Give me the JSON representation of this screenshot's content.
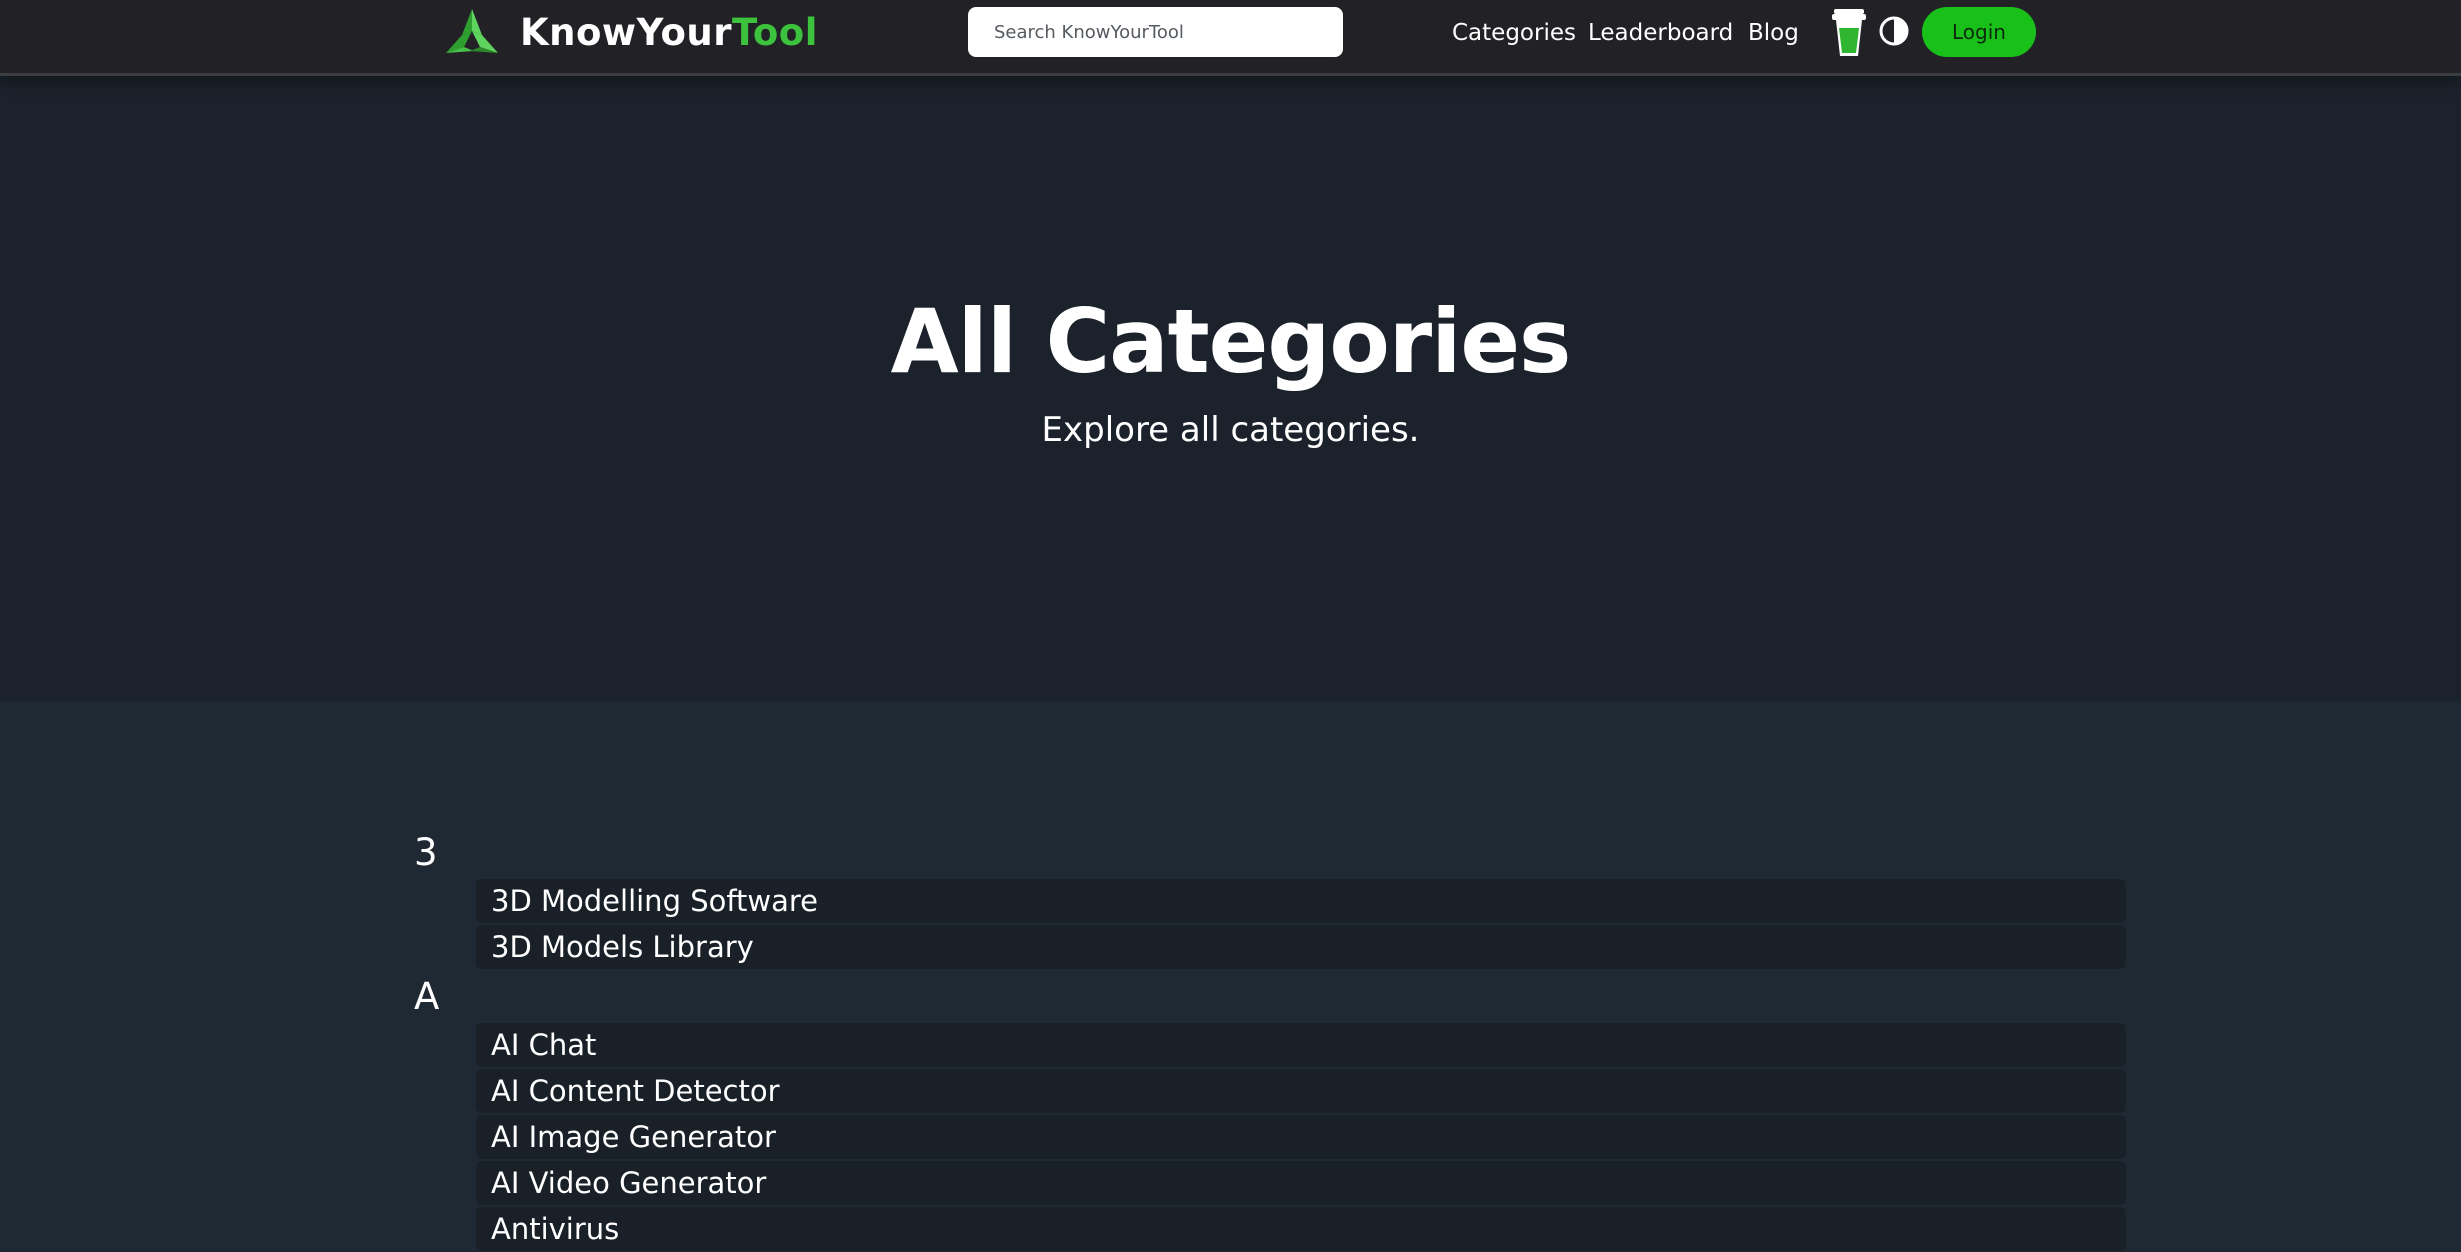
{
  "header": {
    "brand": {
      "name_part1": "KnowYour",
      "name_part2": "Tool"
    },
    "search": {
      "placeholder": "Search KnowYourTool",
      "value": ""
    },
    "nav": [
      {
        "label": "Categories"
      },
      {
        "label": "Leaderboard"
      },
      {
        "label": "Blog"
      }
    ],
    "login_label": "Login"
  },
  "hero": {
    "title": "All Categories",
    "subtitle": "Explore all categories."
  },
  "groups": [
    {
      "letter": "3",
      "items": [
        "3D Modelling Software",
        "3D Models Library"
      ]
    },
    {
      "letter": "A",
      "items": [
        "AI Chat",
        "AI Content Detector",
        "AI Image Generator",
        "AI Video Generator",
        "Antivirus"
      ]
    }
  ],
  "icons": {
    "logo": "knowyourtool-logo",
    "cup": "coffee-cup-icon",
    "theme": "theme-toggle-icon"
  },
  "colors": {
    "accent": "#3cc23c",
    "login_bg": "#19c019",
    "header_bg": "#222226",
    "hero_bg": "#1b222b",
    "list_bg": "#1f2933",
    "item_bg": "#1a2028"
  }
}
